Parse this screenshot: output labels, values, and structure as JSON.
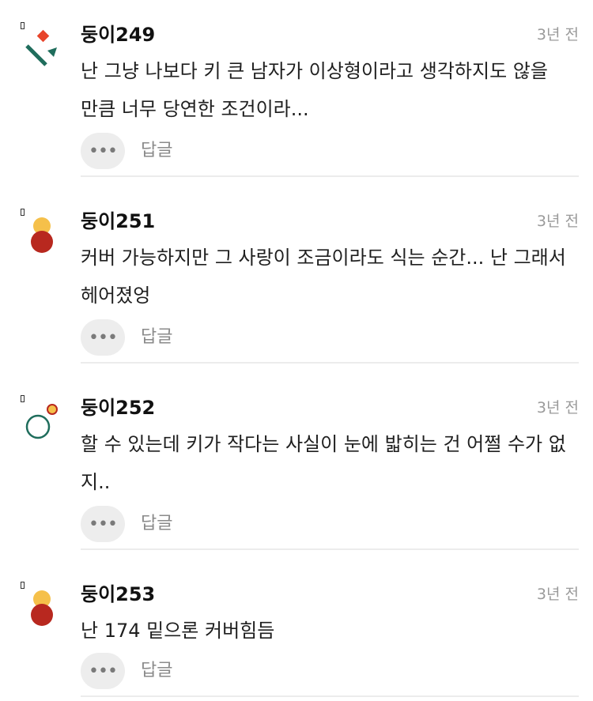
{
  "comments": [
    {
      "author": "둥이249",
      "time": "3년 전",
      "text": "난 그냥 나보다 키 큰 남자가 이상형이라고 생각하지도 않을 만큼 너무 당연한 조건이라...",
      "reply_label": "답글",
      "more_label": "•••",
      "avatar_icon": "geometric-avatar-icon"
    },
    {
      "author": "둥이251",
      "time": "3년 전",
      "text": "커버 가능하지만 그 사랑이 조금이라도 식는 순간... 난 그래서 헤어졌엉",
      "reply_label": "답글",
      "more_label": "•••",
      "avatar_icon": "snowman-avatar-icon"
    },
    {
      "author": "둥이252",
      "time": "3년 전",
      "text": "할 수 있는데 키가 작다는 사실이 눈에 밟히는 건 어쩔 수가 없지..",
      "reply_label": "답글",
      "more_label": "•••",
      "avatar_icon": "circle-avatar-icon"
    },
    {
      "author": "둥이253",
      "time": "3년 전",
      "text": "난 174 밑으론 커버힘듬",
      "reply_label": "답글",
      "more_label": "•••",
      "avatar_icon": "snowman-avatar-icon"
    }
  ],
  "colors": {
    "accent_orange": "#e8452b",
    "accent_green": "#1f6d5c",
    "avatar_yellow": "#f5c04a",
    "avatar_red": "#b8281f",
    "divider": "#ececec"
  }
}
